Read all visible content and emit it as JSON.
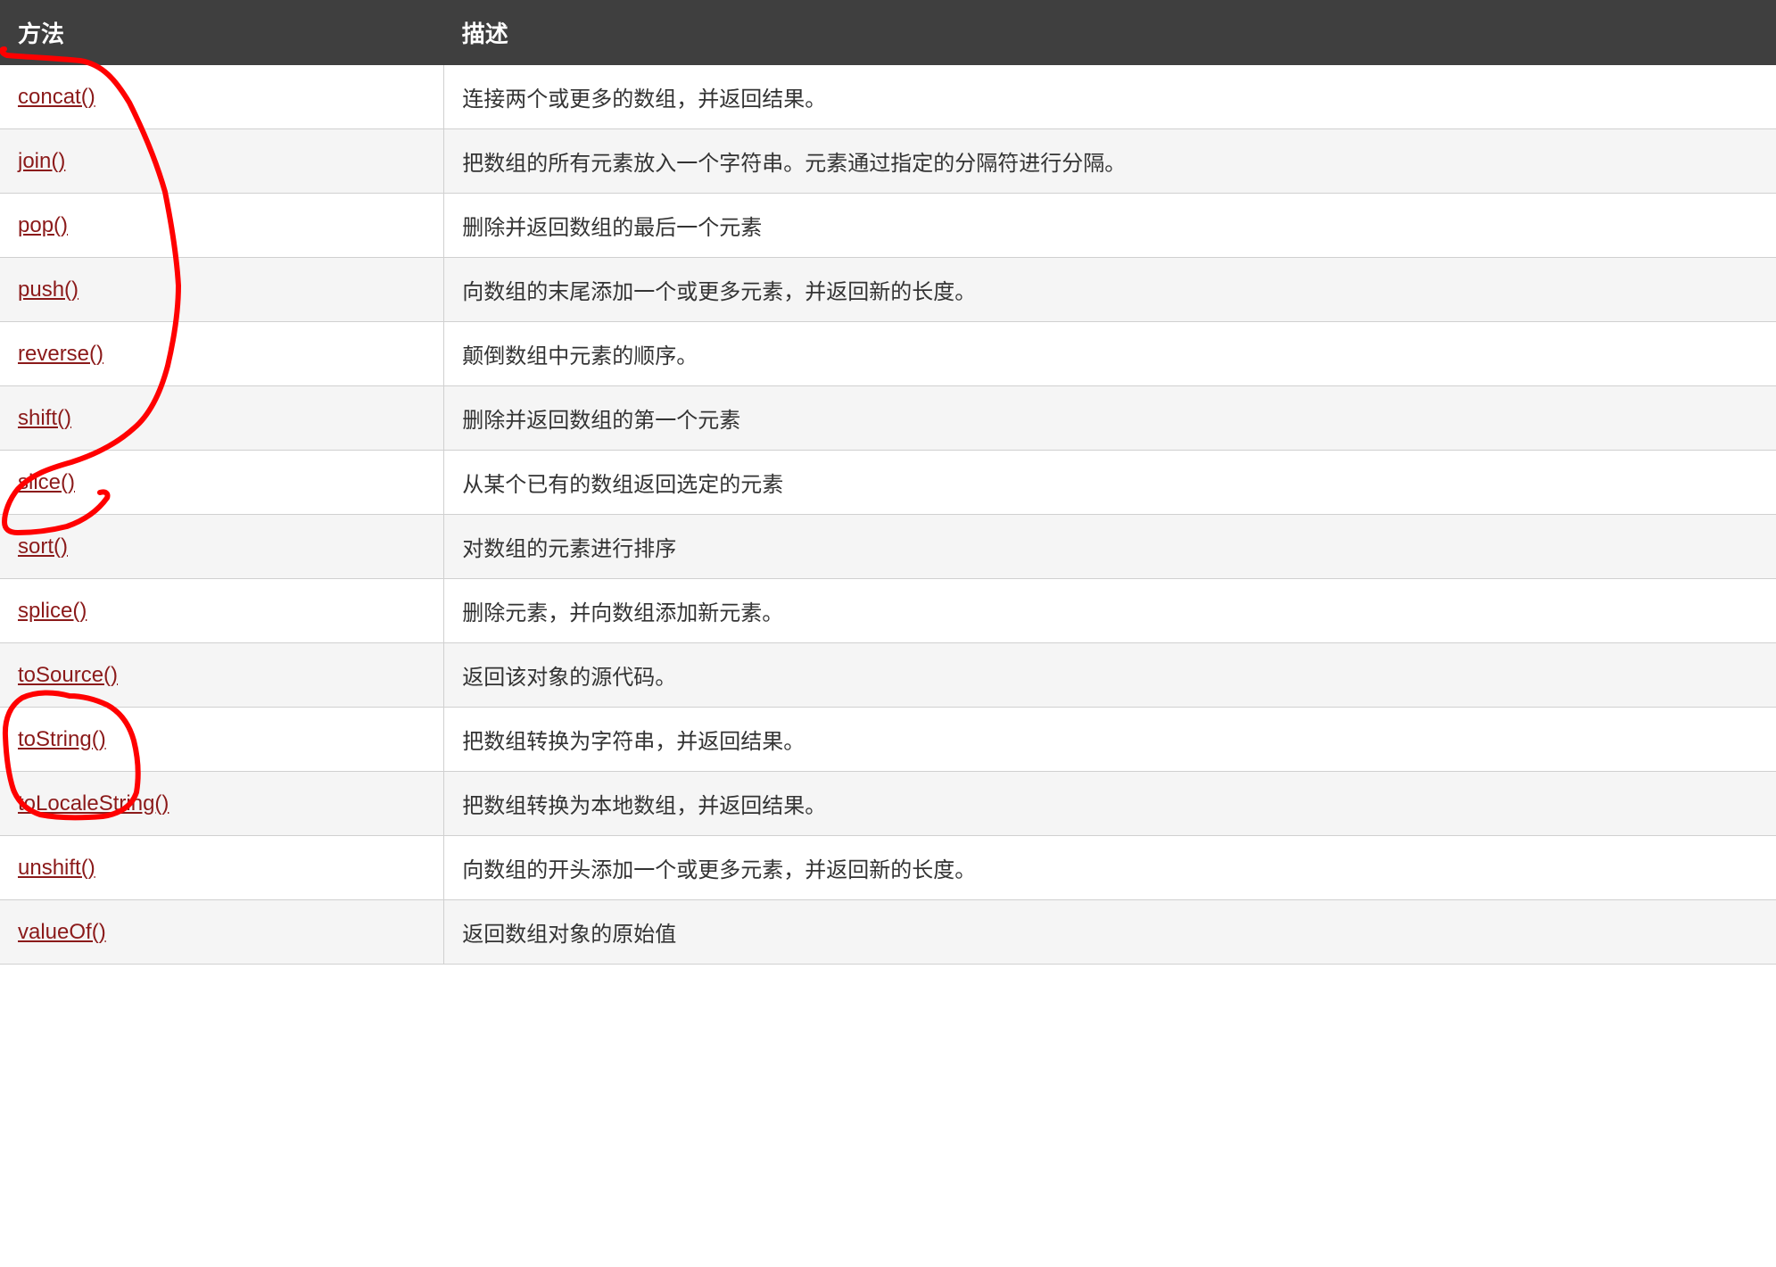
{
  "table": {
    "headers": {
      "method": "方法",
      "description": "描述"
    },
    "rows": [
      {
        "method": "concat()",
        "description": "连接两个或更多的数组，并返回结果。"
      },
      {
        "method": "join()",
        "description": "把数组的所有元素放入一个字符串。元素通过指定的分隔符进行分隔。"
      },
      {
        "method": "pop()",
        "description": "删除并返回数组的最后一个元素"
      },
      {
        "method": "push()",
        "description": "向数组的末尾添加一个或更多元素，并返回新的长度。"
      },
      {
        "method": "reverse()",
        "description": "颠倒数组中元素的顺序。"
      },
      {
        "method": "shift()",
        "description": "删除并返回数组的第一个元素"
      },
      {
        "method": "slice()",
        "description": "从某个已有的数组返回选定的元素"
      },
      {
        "method": "sort()",
        "description": "对数组的元素进行排序"
      },
      {
        "method": "splice()",
        "description": "删除元素，并向数组添加新元素。"
      },
      {
        "method": "toSource()",
        "description": "返回该对象的源代码。"
      },
      {
        "method": "toString()",
        "description": "把数组转换为字符串，并返回结果。"
      },
      {
        "method": "toLocaleString()",
        "description": "把数组转换为本地数组，并返回结果。"
      },
      {
        "method": "unshift()",
        "description": "向数组的开头添加一个或更多元素，并返回新的长度。"
      },
      {
        "method": "valueOf()",
        "description": "返回数组对象的原始值"
      }
    ]
  },
  "annotation_color": "#ff0000"
}
